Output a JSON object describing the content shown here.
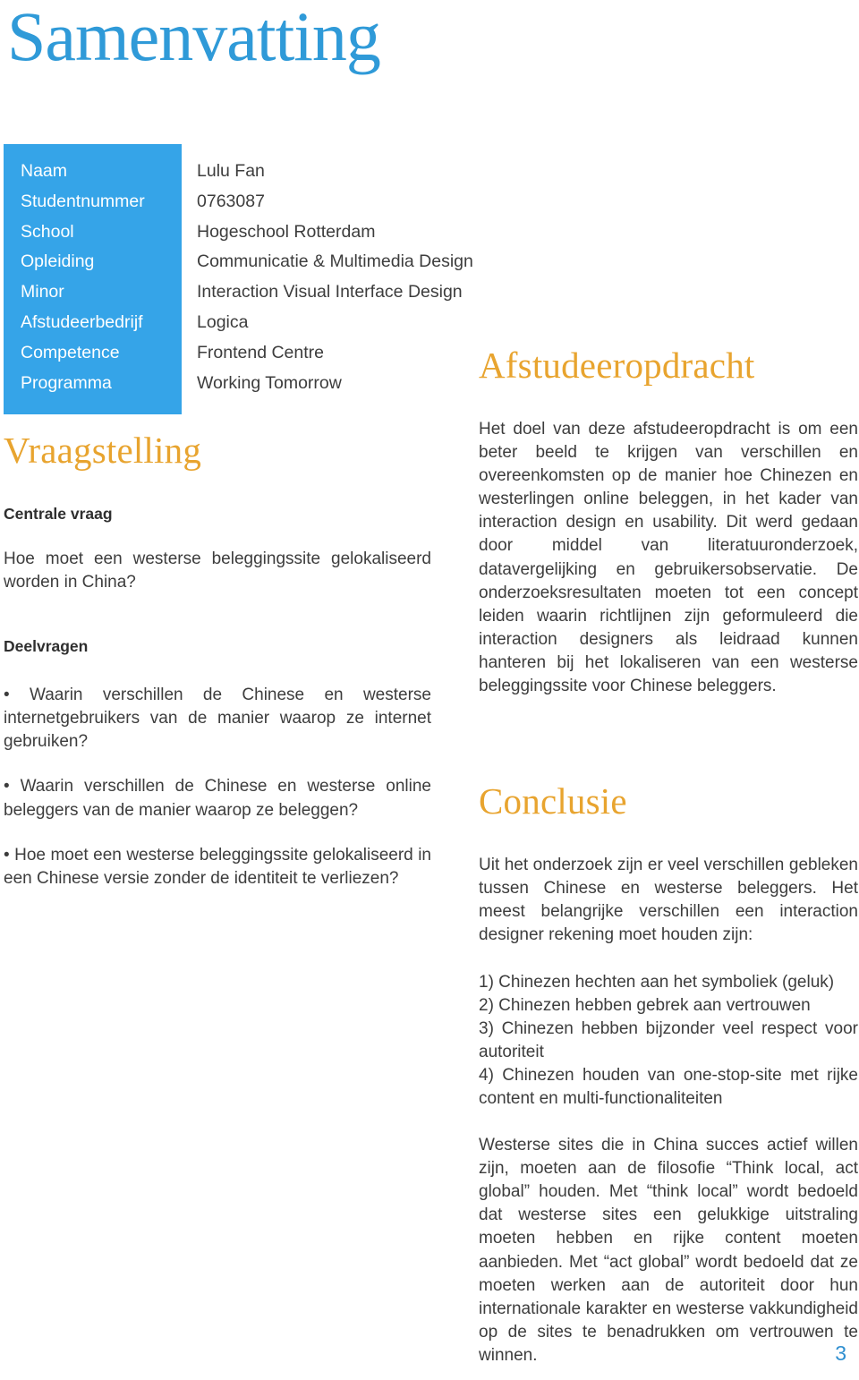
{
  "document": {
    "title": "Samenvatting",
    "page_number": "3"
  },
  "colors": {
    "brand_blue": "#35a4e8",
    "title_blue": "#2f9ad8",
    "heading_orange": "#e8a42f",
    "body_text": "#3d3d3d"
  },
  "meta": {
    "rows": [
      {
        "label": "Naam",
        "value": "Lulu Fan"
      },
      {
        "label": "Studentnummer",
        "value": "0763087"
      },
      {
        "label": "School",
        "value": "Hogeschool Rotterdam"
      },
      {
        "label": "Opleiding",
        "value": "Communicatie & Multimedia Design"
      },
      {
        "label": "Minor",
        "value": "Interaction Visual Interface Design"
      },
      {
        "label": "Afstudeerbedrijf",
        "value": "Logica"
      },
      {
        "label": "Competence",
        "value": "Frontend Centre"
      },
      {
        "label": "Programma",
        "value": "Working Tomorrow"
      }
    ]
  },
  "vraagstelling": {
    "heading": "Vraagstelling",
    "centrale_vraag_label": "Centrale vraag",
    "centrale_vraag_text": "Hoe moet een westerse beleggingssite gelokaliseerd worden in China?",
    "deelvragen_label": "Deelvragen",
    "deelvragen": [
      "• Waarin verschillen de Chinese en westerse internetgebruikers van de manier waarop ze internet gebruiken?",
      "• Waarin verschillen de Chinese en westerse online beleggers van de manier waarop ze beleggen?",
      "• Hoe moet een westerse beleggingssite gelokaliseerd in een Chinese versie zonder de identiteit te verliezen?"
    ]
  },
  "afstudeeropdracht": {
    "heading": "Afstudeeropdracht",
    "paragraph": "Het doel van deze afstudeeropdracht is om een beter beeld te krijgen van verschillen en overeenkomsten op de manier hoe Chinezen en westerlingen online beleggen, in het kader van interaction design en usability. Dit werd gedaan door middel van literatuuronderzoek, datavergelijking en gebruikersobservatie. De onderzoeksresultaten moeten tot een concept leiden waarin richtlijnen zijn geformuleerd die interaction designers als leidraad kunnen hanteren bij het lokaliseren van een westerse beleggingssite voor Chinese beleggers."
  },
  "conclusie": {
    "heading": "Conclusie",
    "intro": "Uit het onderzoek zijn er veel verschillen gebleken tussen Chinese en westerse beleggers. Het meest belangrijke verschillen een interaction designer rekening moet houden zijn:",
    "points": [
      "1) Chinezen hechten aan het symboliek (geluk)",
      "2) Chinezen hebben gebrek aan vertrouwen",
      "3) Chinezen hebben bijzonder veel respect voor autoriteit",
      "4) Chinezen houden van one-stop-site met rijke content en multi-functionaliteiten"
    ],
    "closing": "Westerse sites die in China succes actief willen zijn, moeten aan de filosofie “Think local, act global” houden. Met “think local” wordt bedoeld dat westerse sites een gelukkige uitstraling moeten hebben en rijke content moeten aanbieden. Met “act global” wordt bedoeld dat ze moeten werken aan de autoriteit door hun internationale karakter en westerse vakkundigheid op de sites te benadrukken om vertrouwen te winnen."
  }
}
